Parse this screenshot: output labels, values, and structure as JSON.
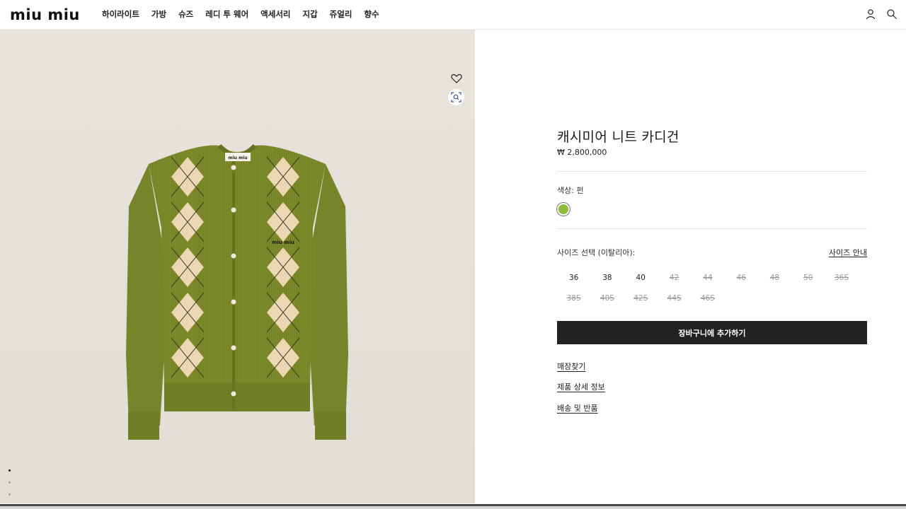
{
  "header": {
    "logo": "miu miu",
    "nav": [
      "하이라이트",
      "가방",
      "슈즈",
      "레디 투 웨어",
      "액세서리",
      "지갑",
      "쥬얼리",
      "향수"
    ]
  },
  "product": {
    "title": "캐시미어 니트 카디건",
    "price": "₩ 2,800,000",
    "color_label": "색상:  펀",
    "color_swatch": "#8cbb3a",
    "size_label": "사이즈 선택 (이탈리아):",
    "size_guide": "사이즈 안내",
    "sizes": [
      {
        "label": "36",
        "available": true
      },
      {
        "label": "38",
        "available": true
      },
      {
        "label": "40",
        "available": true
      },
      {
        "label": "42",
        "available": false
      },
      {
        "label": "44",
        "available": false
      },
      {
        "label": "46",
        "available": false
      },
      {
        "label": "48",
        "available": false
      },
      {
        "label": "50",
        "available": false
      },
      {
        "label": "36S",
        "available": false
      },
      {
        "label": "38S",
        "available": false
      },
      {
        "label": "40S",
        "available": false
      },
      {
        "label": "42S",
        "available": false
      },
      {
        "label": "44S",
        "available": false
      },
      {
        "label": "46S",
        "available": false
      }
    ],
    "add_to_cart": "장바구니에 추가하기",
    "links": {
      "store": "매장찾기",
      "details": "제품 상세 정보",
      "shipping": "배송 및 반품"
    }
  },
  "image": {
    "label_tag": "miu miu",
    "chest_logo": "miu miu",
    "carousel_count": 5,
    "carousel_active": 0
  },
  "colors": {
    "cardigan": "#7c8a2a",
    "argyle_light": "#ecd7b4"
  }
}
